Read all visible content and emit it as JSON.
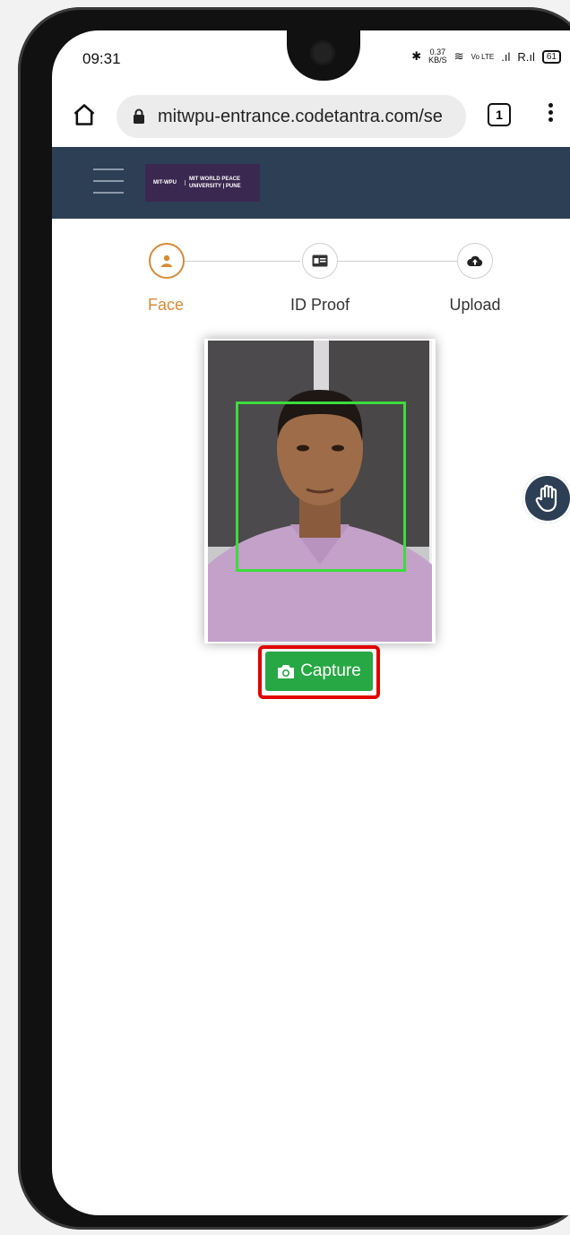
{
  "status_bar": {
    "time": "09:31",
    "network_speed": "0.37",
    "network_unit": "KB/S",
    "volte": "Vo LTE",
    "battery": "61"
  },
  "browser": {
    "url": "mitwpu-entrance.codetantra.com/se",
    "tab_count": "1"
  },
  "site": {
    "logo_left": "MIT-WPU",
    "logo_right_line1": "MIT WORLD PEACE",
    "logo_right_line2": "UNIVERSITY | PUNE"
  },
  "stepper": {
    "steps": [
      {
        "label": "Face",
        "icon": "user-icon",
        "active": true
      },
      {
        "label": "ID Proof",
        "icon": "id-card-icon",
        "active": false
      },
      {
        "label": "Upload",
        "icon": "cloud-upload-icon",
        "active": false
      }
    ]
  },
  "capture": {
    "button_label": "Capture",
    "icon": "camera-icon"
  },
  "colors": {
    "header_bg": "#2d3f55",
    "accent": "#d98a35",
    "capture_green": "#28a745",
    "face_box": "#3ddc3d",
    "highlight": "#e00000"
  }
}
